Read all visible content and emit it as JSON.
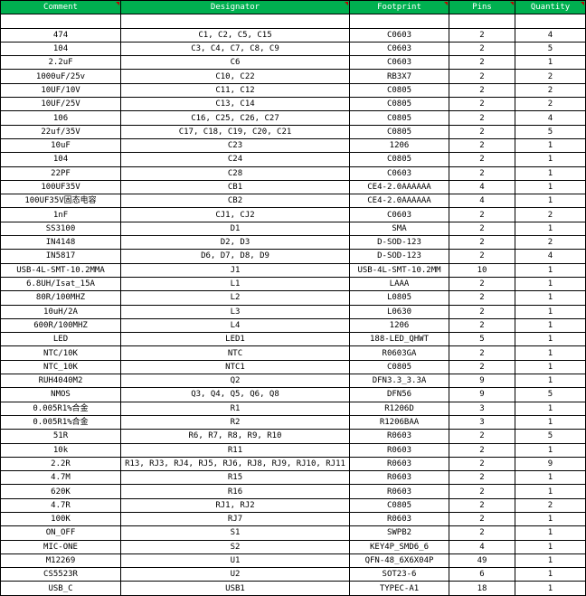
{
  "columns": [
    "Comment",
    "Designator",
    "Footprint",
    "Pins",
    "Quantity"
  ],
  "rows": [
    [
      "",
      "",
      "",
      "",
      ""
    ],
    [
      "474",
      "C1, C2, C5, C15",
      "C0603",
      "2",
      "4"
    ],
    [
      "104",
      "C3, C4, C7, C8, C9",
      "C0603",
      "2",
      "5"
    ],
    [
      "2.2uF",
      "C6",
      "C0603",
      "2",
      "1"
    ],
    [
      "1000uF/25v",
      "C10, C22",
      "RB3X7",
      "2",
      "2"
    ],
    [
      "10UF/10V",
      "C11, C12",
      "C0805",
      "2",
      "2"
    ],
    [
      "10UF/25V",
      "C13, C14",
      "C0805",
      "2",
      "2"
    ],
    [
      "106",
      "C16, C25, C26, C27",
      "C0805",
      "2",
      "4"
    ],
    [
      "22uf/35V",
      "C17, C18, C19, C20, C21",
      "C0805",
      "2",
      "5"
    ],
    [
      "10uF",
      "C23",
      "1206",
      "2",
      "1"
    ],
    [
      "104",
      "C24",
      "C0805",
      "2",
      "1"
    ],
    [
      "22PF",
      "C28",
      "C0603",
      "2",
      "1"
    ],
    [
      "100UF35V",
      "CB1",
      "CE4-2.0AAAAAA",
      "4",
      "1"
    ],
    [
      "100UF35V固态电容",
      "CB2",
      "CE4-2.0AAAAAA",
      "4",
      "1"
    ],
    [
      "1nF",
      "CJ1, CJ2",
      "C0603",
      "2",
      "2"
    ],
    [
      "SS3100",
      "D1",
      "SMA",
      "2",
      "1"
    ],
    [
      "IN4148",
      "D2, D3",
      "D-SOD-123",
      "2",
      "2"
    ],
    [
      "IN5817",
      "D6, D7, D8, D9",
      "D-SOD-123",
      "2",
      "4"
    ],
    [
      "USB-4L-SMT-10.2MMA",
      "J1",
      "USB-4L-SMT-10.2MM",
      "10",
      "1"
    ],
    [
      "6.8UH/Isat_15A",
      "L1",
      "LAAA",
      "2",
      "1"
    ],
    [
      "80R/100MHZ",
      "L2",
      "L0805",
      "2",
      "1"
    ],
    [
      "10uH/2A",
      "L3",
      "L0630",
      "2",
      "1"
    ],
    [
      "600R/100MHZ",
      "L4",
      "1206",
      "2",
      "1"
    ],
    [
      "LED",
      "LED1",
      "188-LED_QHWT",
      "5",
      "1"
    ],
    [
      "NTC/10K",
      "NTC",
      "R0603GA",
      "2",
      "1"
    ],
    [
      "NTC_10K",
      "NTC1",
      "C0805",
      "2",
      "1"
    ],
    [
      "RUH4040M2",
      "Q2",
      "DFN3.3_3.3A",
      "9",
      "1"
    ],
    [
      "NMOS",
      "Q3, Q4, Q5, Q6, Q8",
      "DFN56",
      "9",
      "5"
    ],
    [
      "0.005R1%合金",
      "R1",
      "R1206D",
      "3",
      "1"
    ],
    [
      "0.005R1%合金",
      "R2",
      "R1206BAA",
      "3",
      "1"
    ],
    [
      "51R",
      "R6, R7, R8, R9, R10",
      "R0603",
      "2",
      "5"
    ],
    [
      "10k",
      "R11",
      "R0603",
      "2",
      "1"
    ],
    [
      "2.2R",
      "R13, RJ3, RJ4, RJ5, RJ6, RJ8, RJ9, RJ10, RJ11",
      "R0603",
      "2",
      "9"
    ],
    [
      "4.7M",
      "R15",
      "R0603",
      "2",
      "1"
    ],
    [
      "620K",
      "R16",
      "R0603",
      "2",
      "1"
    ],
    [
      "4.7R",
      "RJ1, RJ2",
      "C0805",
      "2",
      "2"
    ],
    [
      "100K",
      "RJ7",
      "R0603",
      "2",
      "1"
    ],
    [
      "ON_OFF",
      "S1",
      "SWPB2",
      "2",
      "1"
    ],
    [
      "MIC-ONE",
      "S2",
      "KEY4P_SMD6_6",
      "4",
      "1"
    ],
    [
      "M12269",
      "U1",
      "QFN-48_6X6X04P",
      "49",
      "1"
    ],
    [
      "CS5523R",
      "U2",
      "SOT23-6",
      "6",
      "1"
    ],
    [
      "USB_C",
      "USB1",
      "TYPEC-A1",
      "18",
      "1"
    ]
  ],
  "colors": {
    "header_bg": "#00b050",
    "header_text": "#ffffff",
    "corner_marker": "#c00000",
    "grid": "#000000"
  }
}
